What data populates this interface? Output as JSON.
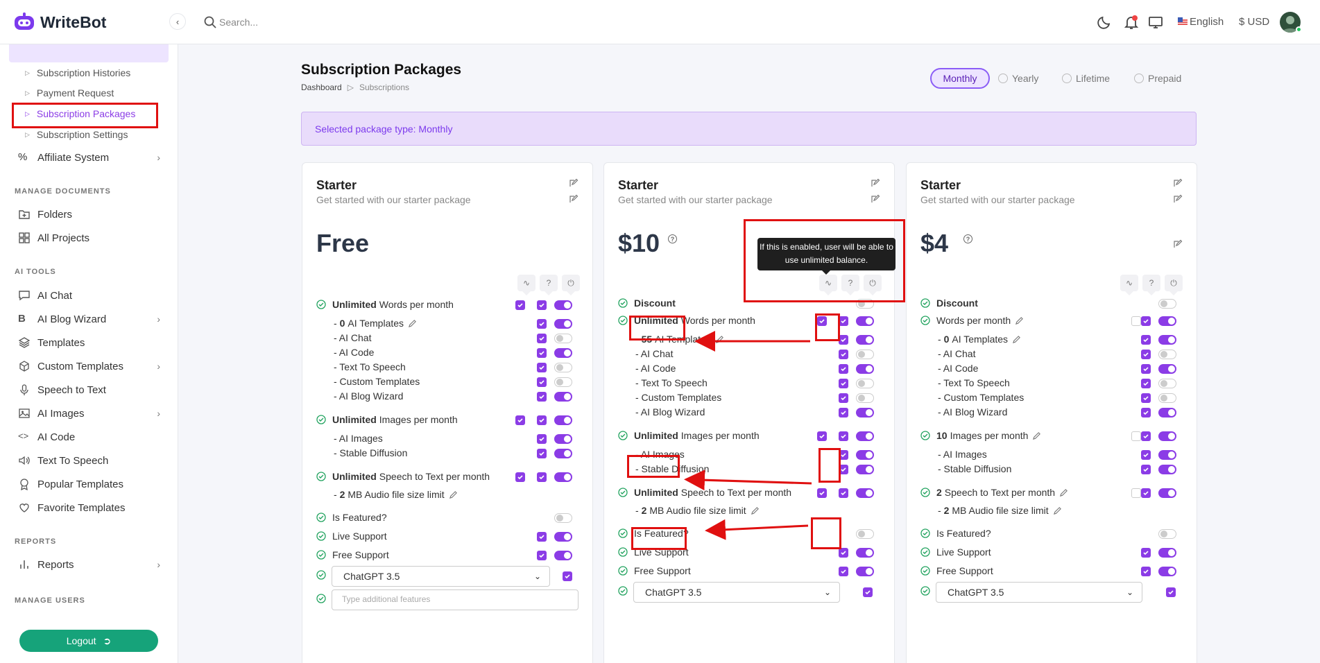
{
  "app": {
    "name": "WriteBot"
  },
  "search": {
    "placeholder": "Search..."
  },
  "topbar": {
    "language": "English",
    "currency": "$ USD"
  },
  "sidebar": {
    "subs": [
      "Subscription Histories",
      "Payment Request",
      "Subscription Packages",
      "Subscription Settings"
    ],
    "affiliate": "Affiliate System",
    "sec_docs": "MANAGE DOCUMENTS",
    "docs": [
      "Folders",
      "All Projects"
    ],
    "sec_ai": "AI TOOLS",
    "ai": [
      "AI Chat",
      "AI Blog Wizard",
      "Templates",
      "Custom Templates",
      "Speech to Text",
      "AI Images",
      "AI Code",
      "Text To Speech",
      "Popular Templates",
      "Favorite Templates"
    ],
    "sec_reports": "REPORTS",
    "reports": "Reports",
    "sec_users": "MANAGE USERS",
    "logout": "Logout"
  },
  "page": {
    "title": "Subscription Packages",
    "crumb_home": "Dashboard",
    "crumb_current": "Subscriptions"
  },
  "tabs": [
    "Monthly",
    "Yearly",
    "Lifetime",
    "Prepaid"
  ],
  "alert": "Selected package type: Monthly",
  "tooltip": "If this is enabled, user will be able to use unlimited balance.",
  "cards": [
    {
      "name": "Starter",
      "desc": "Get started with our starter package",
      "price": "Free",
      "words": {
        "bold": "Unlimited",
        "text": "Words per month"
      },
      "templates": {
        "dash": "- ",
        "bold": "0",
        "text": "AI Templates"
      },
      "tpl_items": [
        "- AI Chat",
        "- AI Code",
        "- Text To Speech",
        "- Custom Templates",
        "- AI Blog Wizard"
      ],
      "images": {
        "bold": "Unlimited",
        "text": "Images per month"
      },
      "img_items": [
        "- AI Images",
        "- Stable Diffusion"
      ],
      "speech": {
        "bold": "Unlimited",
        "text": "Speech to Text per month"
      },
      "audio": {
        "dash": "- ",
        "bold": "2",
        "text": "MB Audio file size limit"
      },
      "featured": "Is Featured?",
      "live": "Live Support",
      "free": "Free Support",
      "model": "ChatGPT 3.5",
      "features_placeholder": "Type additional features"
    },
    {
      "name": "Starter",
      "desc": "Get started with our starter package",
      "price": "$10",
      "discount": "Discount",
      "words": {
        "bold": "Unlimited",
        "text": "Words per month"
      },
      "templates": {
        "dash": "- ",
        "bold": "55",
        "text": "AI Templates"
      },
      "tpl_items": [
        "- AI Chat",
        "- AI Code",
        "- Text To Speech",
        "- Custom Templates",
        "- AI Blog Wizard"
      ],
      "images": {
        "bold": "Unlimited",
        "text": "Images per month"
      },
      "img_items": [
        "- AI Images",
        "- Stable Diffusion"
      ],
      "speech": {
        "bold": "Unlimited",
        "text": "Speech to Text per month"
      },
      "audio": {
        "dash": "- ",
        "bold": "2",
        "text": "MB Audio file size limit"
      },
      "featured": "Is Featured?",
      "live": "Live Support",
      "free": "Free Support",
      "model": "ChatGPT 3.5"
    },
    {
      "name": "Starter",
      "desc": "Get started with our starter package",
      "price": "$4",
      "discount": "Discount",
      "words": {
        "bold": "",
        "text": "Words per month"
      },
      "templates": {
        "dash": "- ",
        "bold": "0",
        "text": "AI Templates"
      },
      "tpl_items": [
        "- AI Chat",
        "- AI Code",
        "- Text To Speech",
        "- Custom Templates",
        "- AI Blog Wizard"
      ],
      "images": {
        "bold": "10",
        "text": "Images per month"
      },
      "img_items": [
        "- AI Images",
        "- Stable Diffusion"
      ],
      "speech": {
        "bold": "2",
        "text": "Speech to Text per month"
      },
      "audio": {
        "dash": "- ",
        "bold": "2",
        "text": "MB Audio file size limit"
      },
      "featured": "Is Featured?",
      "live": "Live Support",
      "free": "Free Support",
      "model": "ChatGPT 3.5"
    }
  ],
  "colors": {
    "accent": "#8b3ce6",
    "logout": "#16a37a",
    "annotation": "#e01010",
    "alert_bg": "#e9dcfb"
  }
}
